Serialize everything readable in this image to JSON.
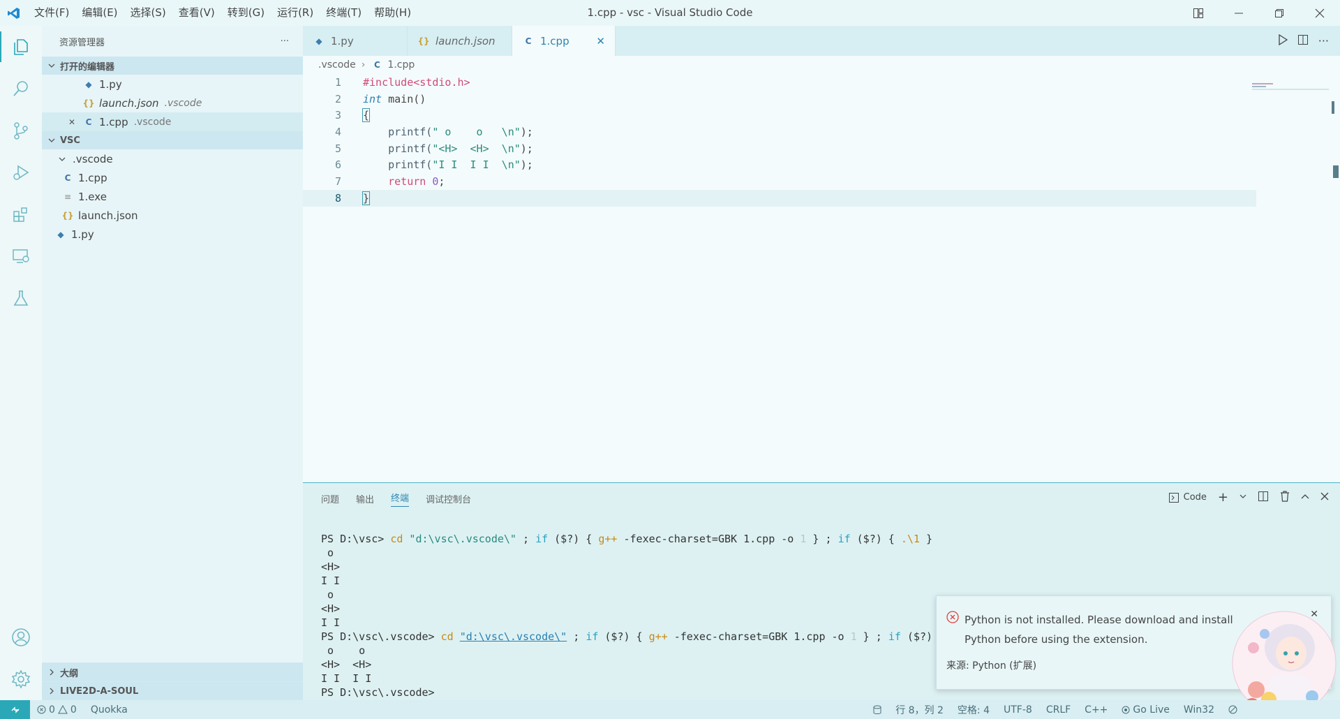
{
  "window": {
    "title": "1.cpp - vsc - Visual Studio Code"
  },
  "menu": [
    "文件(F)",
    "编辑(E)",
    "选择(S)",
    "查看(V)",
    "转到(G)",
    "运行(R)",
    "终端(T)",
    "帮助(H)"
  ],
  "sidebar": {
    "title": "资源管理器",
    "more": "···",
    "open_editors": {
      "label": "打开的编辑器",
      "items": [
        {
          "name": "1.py",
          "dir": ""
        },
        {
          "name": "launch.json",
          "dir": ".vscode"
        },
        {
          "name": "1.cpp",
          "dir": ".vscode"
        }
      ]
    },
    "workspace": {
      "label": "VSC",
      "folder": ".vscode",
      "files": [
        "1.cpp",
        "1.exe",
        "launch.json",
        "1.py"
      ]
    },
    "outline_label": "大纲",
    "live2d_label": "LIVE2D-A-SOUL"
  },
  "tabs": [
    {
      "label": "1.py"
    },
    {
      "label": "launch.json"
    },
    {
      "label": "1.cpp"
    }
  ],
  "breadcrumb": {
    "folder": ".vscode",
    "file": "1.cpp"
  },
  "code": {
    "line_numbers": [
      "1",
      "2",
      "3",
      "4",
      "5",
      "6",
      "7",
      "8"
    ],
    "l1": "#include<stdio.h>",
    "l2_type": "int",
    "l2_rest": " main()",
    "l3": "{",
    "l4_fn": "printf(",
    "l4_str": "\" o    o   \\n\"",
    "l4_end": ");",
    "l5_fn": "printf(",
    "l5_str": "\"<H>  <H>  \\n\"",
    "l5_end": ");",
    "l6_fn": "printf(",
    "l6_str": "\"I I  I I  \\n\"",
    "l6_end": ");",
    "l7_kw": "return",
    "l7_num": "0",
    "l7_end": ";",
    "l8": "}"
  },
  "panel": {
    "tabs": [
      "问题",
      "输出",
      "终端",
      "调试控制台"
    ],
    "active_tab": "终端",
    "shell_label": "Code",
    "terminal": {
      "l1_prompt": "PS D:\\vsc> ",
      "l1_cd": "cd",
      "l1_path": " \"d:\\vsc\\.vscode\\\"",
      "l1_a": " ; ",
      "l1_if1": "if",
      "l1_b": " ($?) { ",
      "l1_gpp": "g++",
      "l1_c": " -fexec-charset=GBK 1.cpp -o ",
      "l1_one": "1",
      "l1_d": " } ; ",
      "l1_if2": "if",
      "l1_e": " ($?) { ",
      "l1_run": ".\\1",
      "l1_f": " }",
      "o1": " o",
      "o2": "<H>",
      "o3": "I I",
      "o4": " o",
      "o5": "<H>",
      "o6": "I I",
      "l8_prompt": "PS D:\\vsc\\.vscode> ",
      "l8_cd": "cd",
      "l8_path": "\"d:\\vsc\\.vscode\\\"",
      "l8_a": " ; ",
      "l8_if1": "if",
      "l8_b": " ($?) { ",
      "l8_gpp": "g++",
      "l8_c": " -fexec-charset=GBK 1.cpp -o ",
      "l8_one": "1",
      "l8_d": " } ; ",
      "l8_if2": "if",
      "l8_e": " ($?)",
      "o7": " o    o",
      "o8": "<H>  <H>",
      "o9": "I I  I I",
      "last_prompt": "PS D:\\vsc\\.vscode>"
    }
  },
  "notification": {
    "message": "Python is not installed. Please download and install Python before using the extension.",
    "source": "来源: Python (扩展)"
  },
  "status": {
    "errors": "0",
    "warnings": "0",
    "quokka": "Quokka",
    "position": "行 8，列 2",
    "spaces": "空格: 4",
    "encoding": "UTF-8",
    "eol": "CRLF",
    "language": "C++",
    "golive": "Go Live",
    "platform": "Win32"
  },
  "colors": {
    "accent": "#2ba8b8",
    "sidebar": "#e7f5f8",
    "panel": "#ddf1f3"
  }
}
